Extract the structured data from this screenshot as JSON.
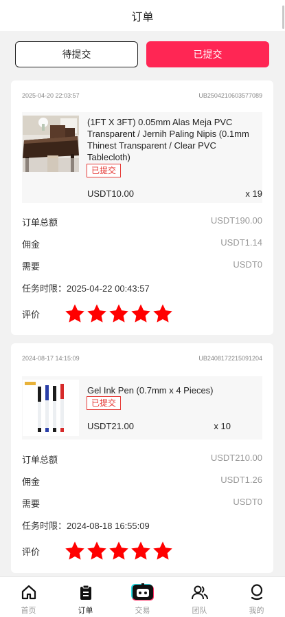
{
  "header": {
    "title": "订单"
  },
  "tabs": [
    {
      "label": "待提交",
      "active": false
    },
    {
      "label": "已提交",
      "active": true
    }
  ],
  "orders": [
    {
      "date": "2025-04-20 22:03:57",
      "order_id": "UB2504210603577089",
      "product_name": "(1FT X 3FT) 0.05mm Alas Meja PVC Transparent / Jernih Paling Nipis (0.1mm Thinest Transparent / Clear PVC Tablecloth)",
      "status": "已提交",
      "price": "USDT10.00",
      "qty": "x 19",
      "total_label": "订单总额",
      "total_value": "USDT190.00",
      "commission_label": "佣金",
      "commission_value": "USDT1.14",
      "need_label": "需要",
      "need_value": "USDT0",
      "deadline": "任务时限：2025-04-22 00:43:57",
      "rating_label": "评价",
      "rating": 5
    },
    {
      "date": "2024-08-17 14:15:09",
      "order_id": "UB2408172215091204",
      "product_name": "Gel Ink Pen (0.7mm x 4 Pieces)",
      "status": "已提交",
      "price": "USDT21.00",
      "qty": "x 10",
      "total_label": "订单总额",
      "total_value": "USDT210.00",
      "commission_label": "佣金",
      "commission_value": "USDT1.26",
      "need_label": "需要",
      "need_value": "USDT0",
      "deadline": "任务时限：2024-08-18 16:55:09",
      "rating_label": "评价",
      "rating": 5
    }
  ],
  "nav": [
    {
      "label": "首页",
      "icon": "home-icon",
      "active": false
    },
    {
      "label": "订单",
      "icon": "clipboard-icon",
      "active": true
    },
    {
      "label": "交易",
      "icon": "robot-icon",
      "active": false
    },
    {
      "label": "团队",
      "icon": "team-icon",
      "active": false
    },
    {
      "label": "我的",
      "icon": "user-icon",
      "active": false
    }
  ],
  "colors": {
    "accent": "#ff2654",
    "star": "#ff0000",
    "badge": "#e53935"
  }
}
